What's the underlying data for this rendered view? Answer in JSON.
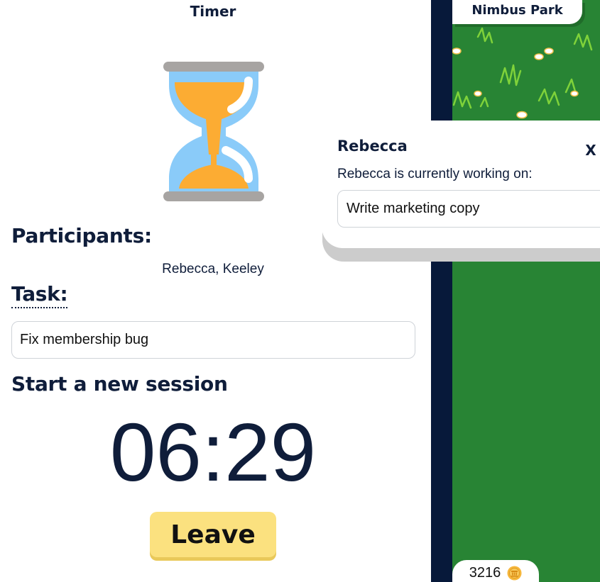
{
  "timer_panel": {
    "title": "Timer",
    "icon": "hourglass-icon",
    "participants_heading": "Participants:",
    "participants": "Rebecca, Keeley",
    "task_heading": "Task:",
    "task_value": "Fix membership bug",
    "session_heading": "Start a new session",
    "time_remaining": "06:29",
    "leave_label": "Leave"
  },
  "map": {
    "location_name": "Nimbus Park"
  },
  "popup": {
    "name": "Rebecca",
    "close_label": "X",
    "caption": "Rebecca is currently working on:",
    "task": "Write marketing copy"
  },
  "coins": {
    "count": "3216",
    "icon": "coin-icon"
  },
  "colors": {
    "navy": "#0f1d3a",
    "grass": "#288434",
    "leave_button": "#fbe17f",
    "hourglass_sand": "#fcac33",
    "hourglass_glass": "#8acbf9"
  }
}
